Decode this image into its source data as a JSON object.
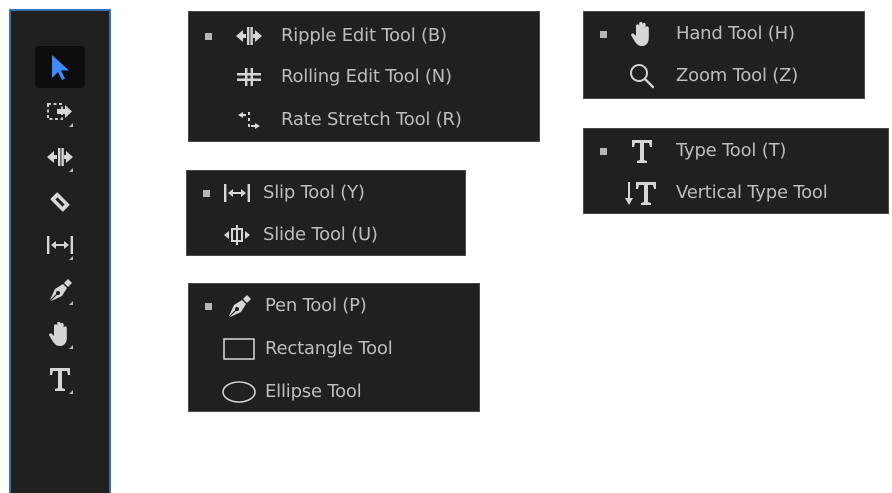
{
  "colors": {
    "panel_bg": "#202020",
    "toolbar_border": "#3e6fb6",
    "selection_arrow": "#3d8cff",
    "text": "#bdbdbd"
  },
  "toolbar": {
    "tools": [
      {
        "name": "selection-tool",
        "icon": "arrow-icon",
        "selected": true
      },
      {
        "name": "track-select-tool",
        "icon": "track-select-icon",
        "selected": false
      },
      {
        "name": "ripple-edit-tool",
        "icon": "ripple-edit-icon",
        "selected": false
      },
      {
        "name": "razor-tool",
        "icon": "razor-icon",
        "selected": false
      },
      {
        "name": "slip-tool",
        "icon": "slip-icon",
        "selected": false
      },
      {
        "name": "pen-tool",
        "icon": "pen-icon",
        "selected": false
      },
      {
        "name": "hand-tool",
        "icon": "hand-icon",
        "selected": false
      },
      {
        "name": "type-tool",
        "icon": "type-icon",
        "selected": false
      }
    ]
  },
  "menus": {
    "ripple_group": {
      "items": [
        {
          "label": "Ripple Edit Tool (B)",
          "icon": "ripple-edit-icon",
          "active": true
        },
        {
          "label": "Rolling Edit Tool (N)",
          "icon": "rolling-edit-icon",
          "active": false
        },
        {
          "label": "Rate Stretch Tool (R)",
          "icon": "rate-stretch-icon",
          "active": false
        }
      ]
    },
    "slip_group": {
      "items": [
        {
          "label": "Slip Tool (Y)",
          "icon": "slip-icon",
          "active": true
        },
        {
          "label": "Slide Tool (U)",
          "icon": "slide-icon",
          "active": false
        }
      ]
    },
    "pen_group": {
      "items": [
        {
          "label": "Pen Tool (P)",
          "icon": "pen-icon",
          "active": true
        },
        {
          "label": "Rectangle Tool",
          "icon": "rectangle-icon",
          "active": false
        },
        {
          "label": "Ellipse Tool",
          "icon": "ellipse-icon",
          "active": false
        }
      ]
    },
    "hand_group": {
      "items": [
        {
          "label": "Hand Tool (H)",
          "icon": "hand-icon",
          "active": true
        },
        {
          "label": "Zoom Tool (Z)",
          "icon": "zoom-icon",
          "active": false
        }
      ]
    },
    "type_group": {
      "items": [
        {
          "label": "Type Tool (T)",
          "icon": "type-icon",
          "active": true
        },
        {
          "label": "Vertical Type Tool",
          "icon": "vertical-type-icon",
          "active": false
        }
      ]
    }
  }
}
